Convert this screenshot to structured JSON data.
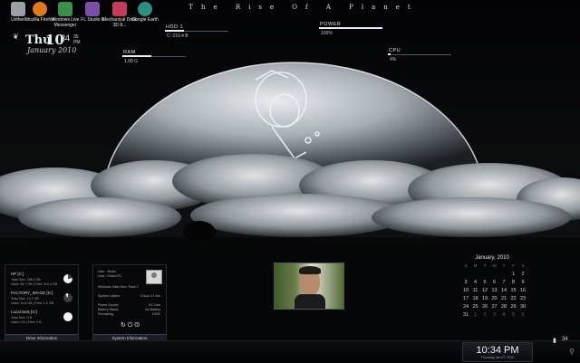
{
  "colors": {
    "accent": "#e8eef3",
    "panel_bg": "#08090b",
    "cloud": "#d9dde1"
  },
  "desktop": {
    "icons": [
      {
        "label": "Uxtheri",
        "icon": "user-icon",
        "color": "#9aa0a6"
      },
      {
        "label": "Mozilla Firefox",
        "icon": "firefox-icon",
        "color": "#e07a1f"
      },
      {
        "label": "Windows Live Messenger",
        "icon": "messenger-icon",
        "color": "#3a8f4a"
      },
      {
        "label": "FL Studio 8",
        "icon": "fl-studio-icon",
        "color": "#7b4fa8"
      },
      {
        "label": "Mechanical Dock 3D 8...",
        "icon": "dock-icon",
        "color": "#c23b5a"
      },
      {
        "label": "Google Earth",
        "icon": "google-earth-icon",
        "color": "#2f8f7f"
      }
    ]
  },
  "title": "The Rise Of A Planet",
  "clock": {
    "day": "Thu",
    "date": "10",
    "time": "34",
    "seconds": "35",
    "ampm": "PM",
    "month_year": "January 2010"
  },
  "meters": {
    "hdd": {
      "label": "HDD 1",
      "value": "C: 210.4 B",
      "fraction": 0.3
    },
    "power": {
      "label": "POWER",
      "value": "100%",
      "fraction": 1.0
    },
    "ram": {
      "label": "RAM",
      "value": "1.88 G",
      "fraction": 0.45
    },
    "cpu": {
      "label": "CPU",
      "value": "4%",
      "fraction": 0.04
    }
  },
  "drives": {
    "footer": "Drive Information",
    "items": [
      {
        "name": "HP [C:]",
        "line1": "Total Size: 286.1 GB",
        "line2": "Used: 65.7 GB  |  Free: 210.4 GB",
        "used": 0.23
      },
      {
        "name": "FACTORY_IMAGE [D:]",
        "line1": "Total Size: 12.0 GB",
        "line2": "Used: 10.8 GB  |  Free: 1.2 GB",
        "used": 0.9
      },
      {
        "name": "Local Disk [G:]",
        "line1": "Total Size: 0 B",
        "line2": "Used: 0 B  |  Free: 0 B",
        "used": 0.0
      }
    ]
  },
  "system": {
    "footer": "System Information",
    "user": "User : Rudio",
    "host": "Host : Rudio-PC",
    "os": "Windows Vista Serv. Pack 2",
    "rows": [
      {
        "label": "System Uptime",
        "value": "0 hour 21 min"
      },
      {
        "label": "Power Source",
        "value": "AC Line"
      },
      {
        "label": "Battery Status",
        "value": "No Battery"
      },
      {
        "label": "Remaining",
        "value": "100%"
      }
    ]
  },
  "calendar": {
    "title": "January, 2010",
    "days": [
      "S",
      "M",
      "T",
      "W",
      "T",
      "F",
      "S"
    ],
    "weeks": [
      [
        "",
        "",
        "",
        "",
        "",
        "1",
        "2"
      ],
      [
        "3",
        "4",
        "5",
        "6",
        "7",
        "8",
        "9"
      ],
      [
        "10",
        "11",
        "12",
        "13",
        "14",
        "15",
        "16"
      ],
      [
        "17",
        "18",
        "19",
        "20",
        "21",
        "22",
        "23"
      ],
      [
        "24",
        "25",
        "26",
        "27",
        "28",
        "29",
        "30"
      ],
      [
        "31",
        "1",
        "2",
        "3",
        "4",
        "5",
        "6"
      ]
    ]
  },
  "taskbar": {
    "time": "10:34 PM",
    "date": "Thursday  Jan 07, 2010",
    "tray_value": "34"
  }
}
